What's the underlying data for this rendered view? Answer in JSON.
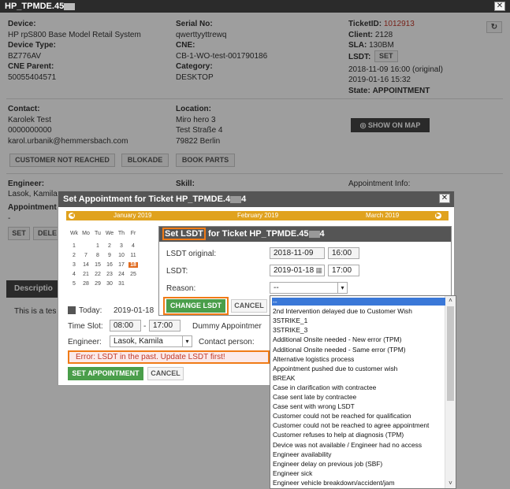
{
  "main": {
    "title": "HP_TPMDE.45",
    "device_label": "Device:",
    "device_value": "HP rpS800 Base Model Retail System",
    "device_type_label": "Device Type:",
    "device_type_value": "BZ776AV",
    "cne_parent_label": "CNE Parent:",
    "cne_parent_value": "50055404571",
    "serial_label": "Serial No:",
    "serial_value": "qwerttyyttrewq",
    "cne_label": "CNE:",
    "cne_value": "CB-1-WO-test-001790186",
    "category_label": "Category:",
    "category_value": "DESKTOP",
    "ticketid_label": "TicketID:",
    "ticketid_value": "1012913",
    "client_label": "Client:",
    "client_value": "2128",
    "sla_label": "SLA:",
    "sla_value": "130BM",
    "lsdt_label": "LSDT:",
    "lsdt_set_btn": "SET",
    "date1": "2018-11-09 16:00 (original)",
    "date2": "2019-01-16 15:32",
    "state_label": "State:",
    "state_value": "APPOINTMENT",
    "contact_label": "Contact:",
    "contact_name": "Karolek Test",
    "contact_phone": "0000000000",
    "contact_email": "karol.urbanik@hemmersbach.com",
    "location_label": "Location:",
    "location_line1": "Miro hero 3",
    "location_line2": "Test Straße 4",
    "location_line3": "79822 Berlin",
    "show_on_map": "SHOW ON MAP",
    "btn_customer_not_reached": "CUSTOMER NOT REACHED",
    "btn_blokade": "BLOKADE",
    "btn_book_parts": "BOOK PARTS",
    "engineer_label": "Engineer:",
    "engineer_value": "Lasok, Kamila",
    "skill_label": "Skill:",
    "appointment_label": "Appointment",
    "appointment_value": "-",
    "appointment_info_label": "Appointment Info:",
    "btn_set": "SET",
    "btn_dele": "DELE",
    "description_tab": "Descriptio",
    "description_text": "This is a tes"
  },
  "appointment_dialog": {
    "title": "Set Appointment for Ticket HP_TPMDE.4",
    "title_suffix": "4",
    "months": [
      "January 2019",
      "February 2019",
      "March 2019"
    ],
    "weekdays": [
      "Wk",
      "Mo",
      "Tu",
      "We",
      "Th",
      "Fr"
    ],
    "weeks": [
      [
        "1",
        "",
        "1",
        "2",
        "3",
        "4"
      ],
      [
        "2",
        "7",
        "8",
        "9",
        "10",
        "11"
      ],
      [
        "3",
        "14",
        "15",
        "16",
        "17",
        "18"
      ],
      [
        "4",
        "21",
        "22",
        "23",
        "24",
        "25"
      ],
      [
        "5",
        "28",
        "29",
        "30",
        "31",
        ""
      ]
    ],
    "today_label": "Today:",
    "today_value": "2019-01-18",
    "time_slot_label": "Time Slot:",
    "time_from": "08:00",
    "time_sep": "-",
    "time_to": "17:00",
    "dummy_label": "Dummy Appointmer",
    "engineer_label": "Engineer:",
    "engineer_value": "Lasok, Kamila",
    "contact_person_label": "Contact person:",
    "error_text": "Error: LSDT in the past. Update LSDT first!",
    "btn_set_appointment": "SET APPOINTMENT",
    "btn_cancel": "CANCEL"
  },
  "lsdt_dialog": {
    "title_highlight": "Set LSDT",
    "title_rest": " for Ticket HP_TPMDE.45",
    "title_suffix": "4",
    "lsdt_original_label": "LSDT original:",
    "lsdt_original_date": "2018-11-09",
    "lsdt_original_time": "16:00",
    "lsdt_label": "LSDT:",
    "lsdt_date": "2019-01-18",
    "lsdt_time": "17:00",
    "reason_label": "Reason:",
    "reason_value": "--",
    "btn_change_lsdt": "CHANGE LSDT",
    "btn_cancel": "CANCEL"
  },
  "reason_options": [
    "--",
    "2nd Intervention delayed due to Customer Wish",
    "3STRIKE_1",
    "3STRIKE_3",
    "Additional Onsite needed - New error (TPM)",
    "Additional Onsite needed - Same error (TPM)",
    "Alternative logistics process",
    "Appointment pushed due to customer wish",
    "BREAK",
    "Case in clarification with contractee",
    "Case sent late by contractee",
    "Case sent with wrong LSDT",
    "Customer could not be reached for qualification",
    "Customer could not be reached to agree appointment",
    "Customer refuses to help at diagnosis (TPM)",
    "Device was not available / Engineer had no access",
    "Engineer availability",
    "Engineer delay on previous job (SBF)",
    "Engineer sick",
    "Engineer vehicle breakdown/accident/jam"
  ],
  "colors": {
    "accent_orange": "#f07b17",
    "ticket_red": "#c0392b",
    "calendar_gold": "#e0a21e",
    "green_button": "#4a9e4a",
    "selection_blue": "#3a78d8"
  }
}
